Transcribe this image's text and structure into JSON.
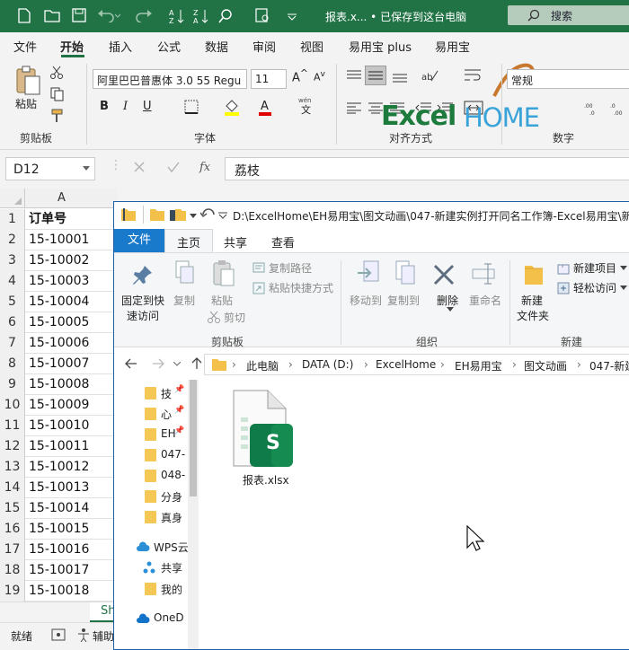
{
  "excel": {
    "doc_title": "报表.x... • 已保存到这台电脑",
    "search_placeholder": "搜索",
    "menu": [
      "文件",
      "开始",
      "插入",
      "公式",
      "数据",
      "审阅",
      "视图",
      "易用宝 plus",
      "易用宝"
    ],
    "clipboard": {
      "paste": "粘贴",
      "group": "剪贴板"
    },
    "font": {
      "name": "阿里巴巴普惠体 3.0 55 Regu",
      "size": "11",
      "group": "字体",
      "bold": "B",
      "italic": "I",
      "underline": "U",
      "phonetic_top": "wén",
      "phonetic_bottom": "文"
    },
    "align_group": "对齐方式",
    "number": {
      "format": "常规",
      "group": "数字"
    },
    "logo": {
      "text1": "Excel",
      "text2": "HOME"
    },
    "name_box": "D12",
    "fx": "fx",
    "formula": "荔枝",
    "column_a": "A",
    "header_label": "订单号",
    "rows": [
      {
        "n": "1",
        "v": "订单号"
      },
      {
        "n": "2",
        "v": "15-10001"
      },
      {
        "n": "3",
        "v": "15-10002"
      },
      {
        "n": "4",
        "v": "15-10003"
      },
      {
        "n": "5",
        "v": "15-10004"
      },
      {
        "n": "6",
        "v": "15-10005"
      },
      {
        "n": "7",
        "v": "15-10006"
      },
      {
        "n": "8",
        "v": "15-10007"
      },
      {
        "n": "9",
        "v": "15-10008"
      },
      {
        "n": "10",
        "v": "15-10009"
      },
      {
        "n": "11",
        "v": "15-10010"
      },
      {
        "n": "12",
        "v": "15-10011"
      },
      {
        "n": "13",
        "v": "15-10012"
      },
      {
        "n": "14",
        "v": "15-10013"
      },
      {
        "n": "15",
        "v": "15-10014"
      },
      {
        "n": "16",
        "v": "15-10015"
      },
      {
        "n": "17",
        "v": "15-10016"
      },
      {
        "n": "18",
        "v": "15-10017"
      },
      {
        "n": "19",
        "v": "15-10018"
      }
    ],
    "sheet_tab": "Sh",
    "status_ready": "就绪",
    "status_aux": "辅助"
  },
  "explorer": {
    "title_path": "D:\\ExcelHome\\EH易用宝\\图文动画\\047-新建实例打开同名工作簿-Excel易用宝\\新",
    "tabs": [
      "文件",
      "主页",
      "共享",
      "查看"
    ],
    "ribbon": {
      "pin": "固定到快速访问",
      "pin_l1": "固定到快",
      "pin_l2": "速访问",
      "copy": "复制",
      "paste": "粘贴",
      "copy_path": "复制路径",
      "paste_shortcut": "粘贴快捷方式",
      "cut": "剪切",
      "group_clipboard": "剪贴板",
      "move_to": "移动到",
      "copy_to": "复制到",
      "delete": "删除",
      "rename": "重命名",
      "group_organize": "组织",
      "new_folder": "新建文件夹",
      "nf_l1": "新建",
      "nf_l2": "文件夹",
      "new_item": "新建项目",
      "easy_access": "轻松访问",
      "group_new": "新建"
    },
    "breadcrumb": [
      "此电脑",
      "DATA (D:)",
      "ExcelHome",
      "EH易用宝",
      "图文动画",
      "047-新建"
    ],
    "nav": {
      "quick": [
        {
          "label": "技"
        },
        {
          "label": "心"
        },
        {
          "label": "EH"
        },
        {
          "label": "047-"
        },
        {
          "label": "048-"
        },
        {
          "label": "分身"
        },
        {
          "label": "真身"
        }
      ],
      "wps": "WPS云",
      "share": "共享",
      "mine": "我的",
      "onedrive": "OneD"
    },
    "file": {
      "name": "报表.xlsx",
      "badge": "S"
    }
  }
}
